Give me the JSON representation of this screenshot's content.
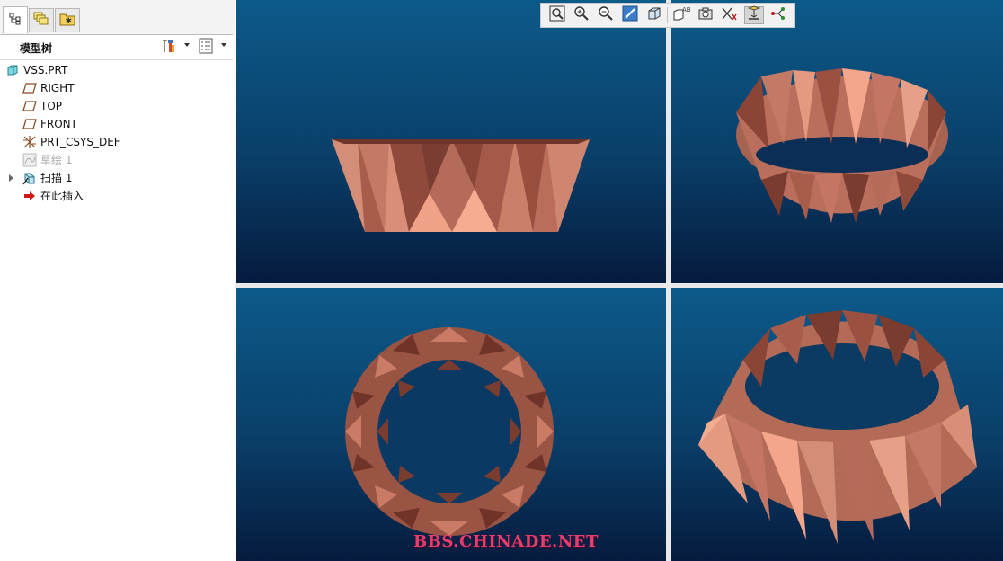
{
  "tabs": [
    {
      "icon": "model-tree-icon"
    },
    {
      "icon": "layers-icon"
    },
    {
      "icon": "favorites-folder-icon"
    }
  ],
  "tree_header": {
    "title": "模型树",
    "settings_icon": "tools-icon",
    "show_icon": "list-settings-icon"
  },
  "tree_items": [
    {
      "label": "VSS.PRT",
      "icon": "part-icon"
    },
    {
      "label": "RIGHT",
      "icon": "datum-plane-icon"
    },
    {
      "label": "TOP",
      "icon": "datum-plane-icon"
    },
    {
      "label": "FRONT",
      "icon": "datum-plane-icon"
    },
    {
      "label": "PRT_CSYS_DEF",
      "icon": "csys-icon"
    },
    {
      "label": "草绘 1",
      "icon": "sketch-icon",
      "dimmed": true
    },
    {
      "label": "扫描 1",
      "icon": "sweep-icon",
      "expandable": true
    },
    {
      "label": "在此插入",
      "icon": "insert-arrow-icon"
    }
  ],
  "toolbar": [
    {
      "name": "refit-button",
      "icon": "zoom-fit-icon"
    },
    {
      "name": "zoom-in-button",
      "icon": "zoom-in-icon"
    },
    {
      "name": "zoom-out-button",
      "icon": "zoom-out-icon"
    },
    {
      "name": "repaint-button",
      "icon": "repaint-icon"
    },
    {
      "name": "display-style-button",
      "icon": "shaded-cube-icon"
    },
    {
      "name": "saved-views-button",
      "icon": "saved-views-icon"
    },
    {
      "name": "view-manager-button",
      "icon": "camera-icon"
    },
    {
      "name": "datum-display-button",
      "icon": "datum-display-icon"
    },
    {
      "name": "spin-center-button",
      "icon": "spin-center-icon",
      "active": true
    },
    {
      "name": "annotation-display-button",
      "icon": "annotation-icon"
    }
  ],
  "colors": {
    "shape_light": "#f3a68c",
    "shape_mid": "#c47563",
    "shape_dark": "#7b3c30",
    "viewport_top": "#0c5a8a",
    "viewport_bottom": "#061b3e",
    "watermark": "#e83c6c"
  },
  "watermark": "BBS.CHINADE.NET"
}
